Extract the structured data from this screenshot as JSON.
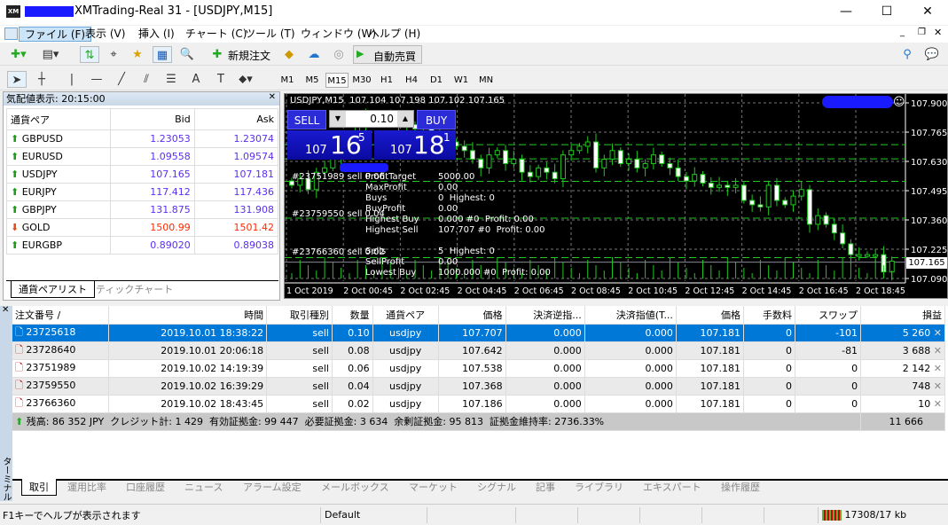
{
  "window": {
    "title": "XMTrading-Real 31 - [USDJPY,M15]",
    "logo": "XM",
    "controls": [
      "—",
      "☐",
      "✕"
    ]
  },
  "menu": [
    "ファイル (F)",
    "表示 (V)",
    "挿入 (I)",
    "チャート (C)",
    "ツール (T)",
    "ウィンドウ (W)",
    "ヘルプ (H)"
  ],
  "toolbar": {
    "new_order": "新規注文",
    "auto_trade": "自動売買"
  },
  "timeframes": [
    "M1",
    "M5",
    "M15",
    "M30",
    "H1",
    "H4",
    "D1",
    "W1",
    "MN"
  ],
  "timeframe_selected": "M15",
  "market_watch": {
    "title": "気配値表示: 20:15:00",
    "columns": [
      "通貨ペア",
      "Bid",
      "Ask"
    ],
    "rows": [
      {
        "symbol": "GBPUSD",
        "bid": "1.23053",
        "ask": "1.23074",
        "dir": "up"
      },
      {
        "symbol": "EURUSD",
        "bid": "1.09558",
        "ask": "1.09574",
        "dir": "up"
      },
      {
        "symbol": "USDJPY",
        "bid": "107.165",
        "ask": "107.181",
        "dir": "up"
      },
      {
        "symbol": "EURJPY",
        "bid": "117.412",
        "ask": "117.436",
        "dir": "up"
      },
      {
        "symbol": "GBPJPY",
        "bid": "131.875",
        "ask": "131.908",
        "dir": "up"
      },
      {
        "symbol": "GOLD",
        "bid": "1500.99",
        "ask": "1501.42",
        "dir": "down"
      },
      {
        "symbol": "EURGBP",
        "bid": "0.89020",
        "ask": "0.89038",
        "dir": "up"
      }
    ],
    "tabs": [
      "通貨ペアリスト",
      "ティックチャート"
    ]
  },
  "chart": {
    "header": "USDJPY,M15  107.104 107.198 107.102 107.165",
    "sell_label": "SELL",
    "buy_label": "BUY",
    "lot": "0.10",
    "sell_price": {
      "big": "107",
      "main": "16",
      "sup": "5"
    },
    "buy_price": {
      "big": "107",
      "main": "18",
      "sup": "1"
    },
    "order_labels": [
      "#23751989 sell 0.06",
      "#23759550 sell 0.04",
      "#23766360 sell 0.02"
    ],
    "ea_info": [
      [
        "ProfitTarget",
        "5000.00"
      ],
      [
        "MaxProfit",
        "0.00"
      ],
      [
        "Buys",
        "0  Highest: 0"
      ],
      [
        "BuyProfit",
        "0.00"
      ],
      [
        "Highest Buy",
        "0.000 #0  Profit: 0.00"
      ],
      [
        "Highest Sell",
        "107.707 #0  Profit: 0.00"
      ],
      [
        "",
        ""
      ],
      [
        "Sells",
        "5  Highest: 0"
      ],
      [
        "SellProfit",
        "0.00"
      ],
      [
        "Lowest Buy",
        "1000.000 #0  Profit: 0.00"
      ]
    ],
    "current_price": "107.165"
  },
  "chart_data": {
    "type": "candlestick",
    "ylim": [
      107.09,
      107.9
    ],
    "yticks": [
      "107.900",
      "107.765",
      "107.630",
      "107.495",
      "107.360",
      "107.225",
      "107.090"
    ],
    "xticks": [
      "1 Oct 2019",
      "2 Oct 00:45",
      "2 Oct 02:45",
      "2 Oct 04:45",
      "2 Oct 06:45",
      "2 Oct 08:45",
      "2 Oct 10:45",
      "2 Oct 12:45",
      "2 Oct 14:45",
      "2 Oct 16:45",
      "2 Oct 18:45"
    ],
    "closes": [
      107.52,
      107.55,
      107.5,
      107.58,
      107.6,
      107.65,
      107.68,
      107.72,
      107.8,
      107.84,
      107.82,
      107.83,
      107.81,
      107.82,
      107.8,
      107.78,
      107.8,
      107.76,
      107.74,
      107.72,
      107.7,
      107.68,
      107.64,
      107.6,
      107.66,
      107.68,
      107.62,
      107.64,
      107.58,
      107.56,
      107.6,
      107.58,
      107.55,
      107.66,
      107.68,
      107.7,
      107.72,
      107.6,
      107.64,
      107.68,
      107.62,
      107.64,
      107.6,
      107.62,
      107.66,
      107.62,
      107.6,
      107.56,
      107.54,
      107.57,
      107.53,
      107.51,
      107.52,
      107.51,
      107.52,
      107.45,
      107.43,
      107.42,
      107.52,
      107.45,
      107.43,
      107.47,
      107.5,
      107.34,
      107.38,
      107.34,
      107.3,
      107.25,
      107.2,
      107.2,
      107.2,
      107.2,
      107.12,
      107.17
    ],
    "sell_levels": [
      107.707,
      107.642,
      107.538,
      107.368,
      107.186
    ]
  },
  "terminal": {
    "columns": [
      "注文番号 /",
      "時間",
      "取引種別",
      "数量",
      "通貨ペア",
      "価格",
      "決済逆指...",
      "決済指値(T...",
      "価格",
      "手数料",
      "スワップ",
      "損益"
    ],
    "rows": [
      [
        "23725618",
        "2019.10.01 18:38:22",
        "sell",
        "0.10",
        "usdjpy",
        "107.707",
        "0.000",
        "0.000",
        "107.181",
        "0",
        "-101",
        "5 260"
      ],
      [
        "23728640",
        "2019.10.01 20:06:18",
        "sell",
        "0.08",
        "usdjpy",
        "107.642",
        "0.000",
        "0.000",
        "107.181",
        "0",
        "-81",
        "3 688"
      ],
      [
        "23751989",
        "2019.10.02 14:19:39",
        "sell",
        "0.06",
        "usdjpy",
        "107.538",
        "0.000",
        "0.000",
        "107.181",
        "0",
        "0",
        "2 142"
      ],
      [
        "23759550",
        "2019.10.02 16:39:29",
        "sell",
        "0.04",
        "usdjpy",
        "107.368",
        "0.000",
        "0.000",
        "107.181",
        "0",
        "0",
        "748"
      ],
      [
        "23766360",
        "2019.10.02 18:43:45",
        "sell",
        "0.02",
        "usdjpy",
        "107.186",
        "0.000",
        "0.000",
        "107.181",
        "0",
        "0",
        "10"
      ]
    ],
    "summary": "残高: 86 352 JPY  クレジット計: 1 429  有効証拠金: 99 447  必要証拠金: 3 634  余剰証拠金: 95 813  証拠金維持率: 2736.33%",
    "summary_total": "11 666",
    "side_label": "ターミナル",
    "tabs": [
      "取引",
      "運用比率",
      "口座履歴",
      "ニュース",
      "アラーム設定",
      "メールボックス",
      "マーケット",
      "シグナル",
      "記事",
      "ライブラリ",
      "エキスパート",
      "操作履歴"
    ]
  },
  "statusbar": {
    "help": "F1キーでヘルプが表示されます",
    "profile": "Default",
    "traffic": "17308/17 kb"
  }
}
